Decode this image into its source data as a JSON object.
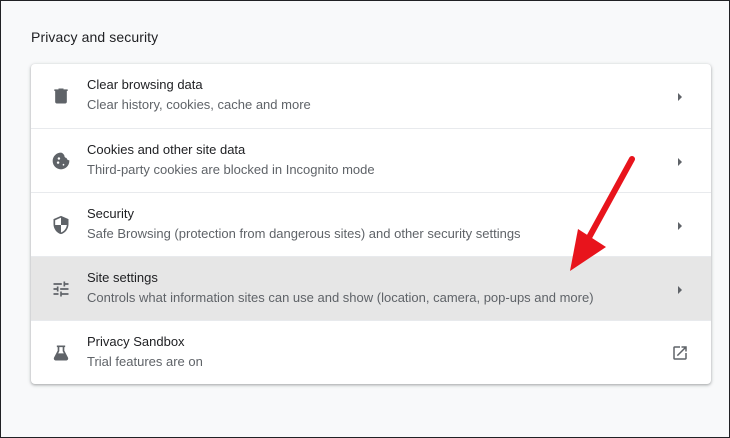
{
  "section": {
    "title": "Privacy and security"
  },
  "items": [
    {
      "title": "Clear browsing data",
      "subtitle": "Clear history, cookies, cache and more",
      "icon": "trash-icon"
    },
    {
      "title": "Cookies and other site data",
      "subtitle": "Third-party cookies are blocked in Incognito mode",
      "icon": "cookie-icon"
    },
    {
      "title": "Security",
      "subtitle": "Safe Browsing (protection from dangerous sites) and other security settings",
      "icon": "shield-icon"
    },
    {
      "title": "Site settings",
      "subtitle": "Controls what information sites can use and show (location, camera, pop-ups and more)",
      "icon": "sliders-icon"
    },
    {
      "title": "Privacy Sandbox",
      "subtitle": "Trial features are on",
      "icon": "flask-icon"
    }
  ],
  "colors": {
    "highlight_row": "#e6e6e6",
    "arrow": "#e8141c",
    "icon": "#5f6368"
  }
}
